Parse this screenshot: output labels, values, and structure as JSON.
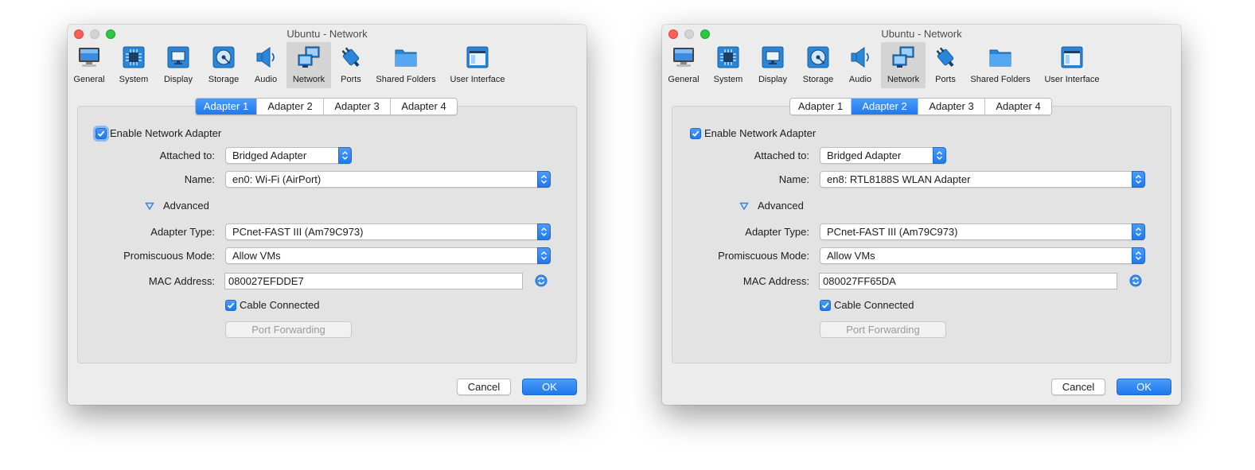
{
  "colors": {
    "accent": "#2a82f2",
    "window_bg": "#ececec",
    "panel_bg": "#e3e3e3"
  },
  "toolbar": [
    {
      "label": "General",
      "icon": "general-icon"
    },
    {
      "label": "System",
      "icon": "system-chip-icon"
    },
    {
      "label": "Display",
      "icon": "display-monitor-icon"
    },
    {
      "label": "Storage",
      "icon": "storage-disk-icon"
    },
    {
      "label": "Audio",
      "icon": "audio-speaker-icon"
    },
    {
      "label": "Network",
      "icon": "network-icon"
    },
    {
      "label": "Ports",
      "icon": "ports-plug-icon"
    },
    {
      "label": "Shared Folders",
      "icon": "shared-folder-icon"
    },
    {
      "label": "User Interface",
      "icon": "user-interface-window-icon"
    }
  ],
  "tabs": [
    "Adapter 1",
    "Adapter 2",
    "Adapter 3",
    "Adapter 4"
  ],
  "labels": {
    "enable_adapter": "Enable Network Adapter",
    "attached_to": "Attached to:",
    "name": "Name:",
    "advanced": "Advanced",
    "adapter_type": "Adapter Type:",
    "promiscuous_mode": "Promiscuous Mode:",
    "mac_address": "MAC Address:",
    "cable_connected": "Cable Connected",
    "port_forwarding": "Port Forwarding",
    "cancel": "Cancel",
    "ok": "OK"
  },
  "windows": [
    {
      "title": "Ubuntu - Network",
      "selected_toolbar": "Network",
      "active_tab": "Adapter 1",
      "enable_adapter": true,
      "attached_to": "Bridged Adapter",
      "name": "en0: Wi-Fi (AirPort)",
      "adapter_type": "PCnet-FAST III (Am79C973)",
      "promiscuous_mode": "Allow VMs",
      "mac_address": "080027EFDDE7",
      "cable_connected": true
    },
    {
      "title": "Ubuntu - Network",
      "selected_toolbar": "Network",
      "active_tab": "Adapter 2",
      "enable_adapter": true,
      "attached_to": "Bridged Adapter",
      "name": "en8: RTL8188S WLAN Adapter",
      "adapter_type": "PCnet-FAST III (Am79C973)",
      "promiscuous_mode": "Allow VMs",
      "mac_address": "080027FF65DA",
      "cable_connected": true
    }
  ]
}
